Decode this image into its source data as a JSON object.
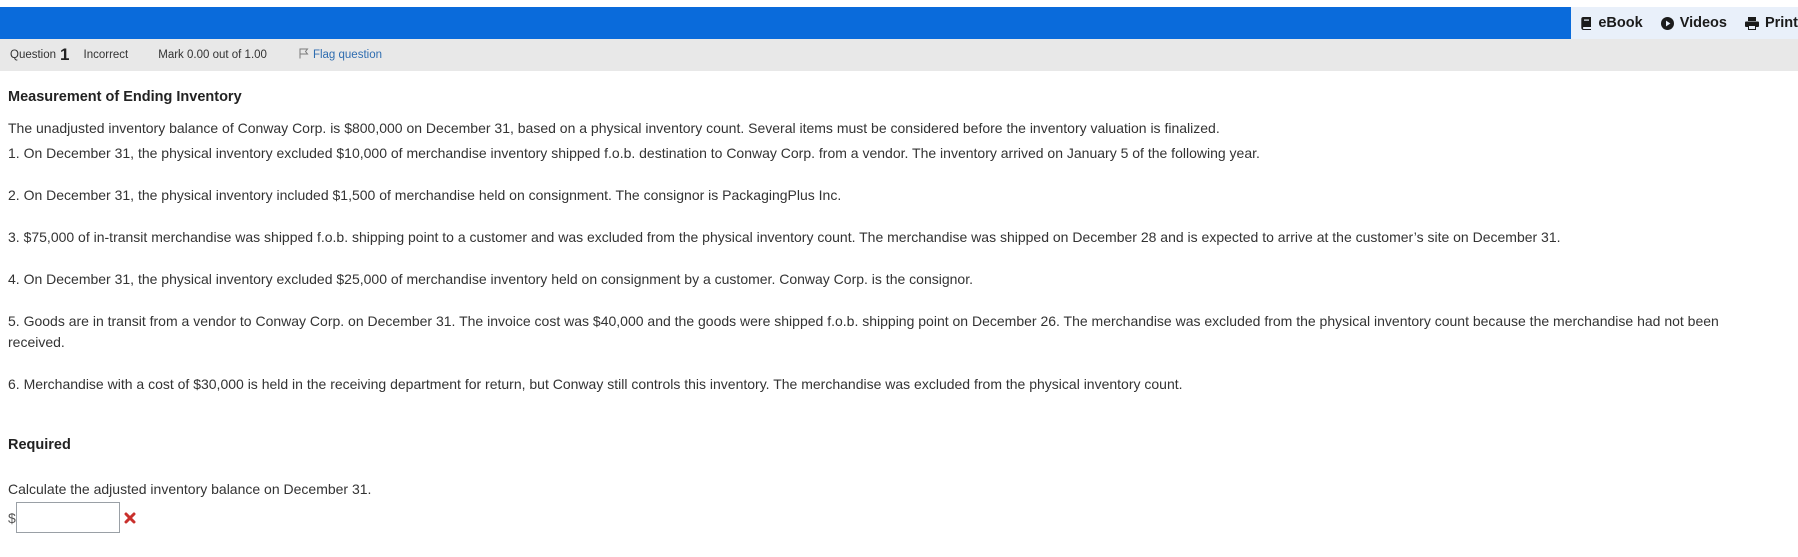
{
  "toolbar": {
    "ebook_label": "eBook",
    "videos_label": "Videos",
    "print_label": "Print"
  },
  "info": {
    "question_label": "Question",
    "question_number": "1",
    "state": "Incorrect",
    "mark": "Mark 0.00 out of 1.00",
    "flag_label": "Flag question"
  },
  "question": {
    "title": "Measurement of Ending Inventory",
    "intro": "The unadjusted inventory balance of Conway Corp. is $800,000 on December 31, based on a physical inventory count. Several items must be considered before the inventory valuation is finalized.",
    "items": [
      "1. On December 31, the physical inventory excluded $10,000 of merchandise inventory shipped f.o.b. destination to Conway Corp. from a vendor. The inventory arrived on January 5 of the following year.",
      "2. On December 31, the physical inventory included $1,500 of merchandise held on consignment. The consignor is PackagingPlus Inc.",
      "3. $75,000 of in-transit merchandise was shipped f.o.b. shipping point to a customer and was excluded from the physical inventory count. The merchandise was shipped on December 28 and is expected to arrive at the customer’s site on December 31.",
      "4. On December 31, the physical inventory excluded $25,000 of merchandise inventory held on consignment by a customer. Conway Corp. is the consignor.",
      "5. Goods are in transit from a vendor to Conway Corp. on December 31. The invoice cost was $40,000 and the goods were shipped f.o.b. shipping point on December 26. The merchandise was excluded from the physical inventory count because the merchandise had not been received.",
      "6. Merchandise with a cost of $30,000 is held in the receiving department for return, but Conway still controls this inventory. The merchandise was excluded from the physical inventory count."
    ],
    "required_label": "Required",
    "prompt": "Calculate the adjusted inventory balance on December 31.",
    "currency_symbol": "$",
    "answer_value": ""
  },
  "colors": {
    "header_blue": "#0a6bdb",
    "info_bar_gray": "#e8e8e8",
    "incorrect_red": "#c9302c",
    "link_blue": "#2f6db0"
  },
  "icons": {
    "ebook": "book-icon",
    "videos": "play-circle-icon",
    "print": "printer-icon",
    "flag": "flag-icon",
    "incorrect": "x-mark-icon"
  }
}
